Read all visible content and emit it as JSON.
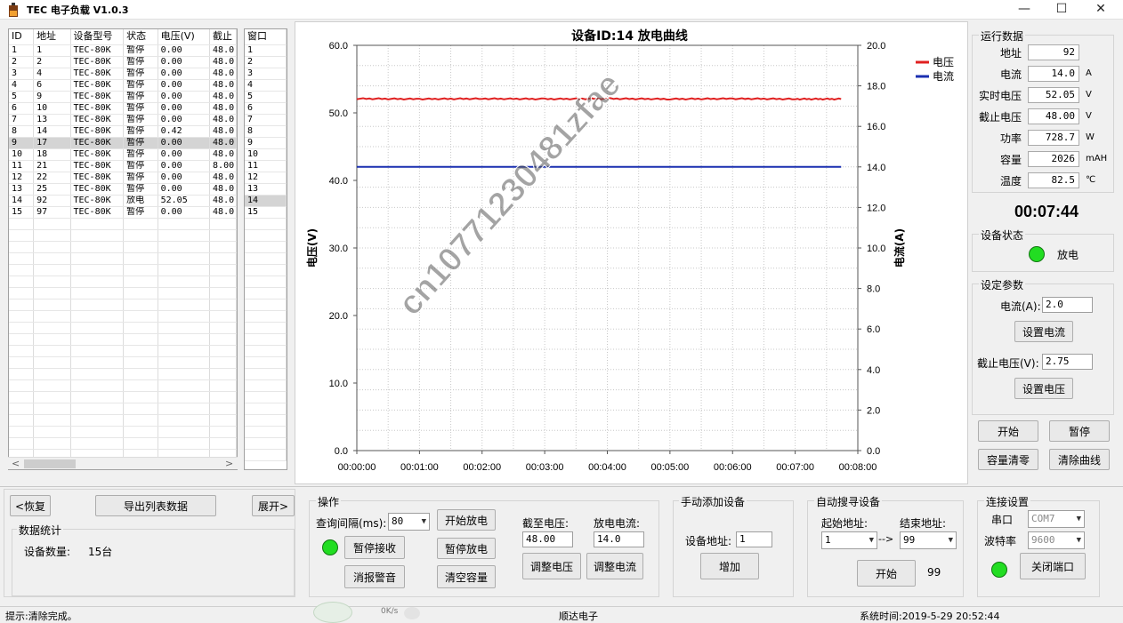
{
  "window": {
    "title": "TEC 电子负载 V1.0.3",
    "minimize": "—",
    "maximize": "☐",
    "close": "✕"
  },
  "device_table": {
    "headers": [
      "ID",
      "地址",
      "设备型号",
      "状态",
      "电压(V)",
      "截止"
    ],
    "rows": [
      [
        "1",
        "1",
        "TEC-80K",
        "暂停",
        "0.00",
        "48.0"
      ],
      [
        "2",
        "2",
        "TEC-80K",
        "暂停",
        "0.00",
        "48.0"
      ],
      [
        "3",
        "4",
        "TEC-80K",
        "暂停",
        "0.00",
        "48.0"
      ],
      [
        "4",
        "6",
        "TEC-80K",
        "暂停",
        "0.00",
        "48.0"
      ],
      [
        "5",
        "9",
        "TEC-80K",
        "暂停",
        "0.00",
        "48.0"
      ],
      [
        "6",
        "10",
        "TEC-80K",
        "暂停",
        "0.00",
        "48.0"
      ],
      [
        "7",
        "13",
        "TEC-80K",
        "暂停",
        "0.00",
        "48.0"
      ],
      [
        "8",
        "14",
        "TEC-80K",
        "暂停",
        "0.42",
        "48.0"
      ],
      [
        "9",
        "17",
        "TEC-80K",
        "暂停",
        "0.00",
        "48.0"
      ],
      [
        "10",
        "18",
        "TEC-80K",
        "暂停",
        "0.00",
        "48.0"
      ],
      [
        "11",
        "21",
        "TEC-80K",
        "暂停",
        "0.00",
        "8.00"
      ],
      [
        "12",
        "22",
        "TEC-80K",
        "暂停",
        "0.00",
        "48.0"
      ],
      [
        "13",
        "25",
        "TEC-80K",
        "暂停",
        "0.00",
        "48.0"
      ],
      [
        "14",
        "92",
        "TEC-80K",
        "放电",
        "52.05",
        "48.0"
      ],
      [
        "15",
        "97",
        "TEC-80K",
        "暂停",
        "0.00",
        "48.0"
      ]
    ],
    "selected_row": 9,
    "scroll_left": "<",
    "scroll_right": ">"
  },
  "window_table": {
    "header": "窗口",
    "rows": [
      "1",
      "2",
      "3",
      "4",
      "5",
      "6",
      "7",
      "8",
      "9",
      "10",
      "11",
      "12",
      "13",
      "14",
      "15"
    ],
    "selected_row": 14
  },
  "chart_data": {
    "type": "line",
    "title": "设备ID:14 放电曲线",
    "ylabel": "电压(V)",
    "y2label": "电流(A)",
    "ylim": [
      0,
      60
    ],
    "y2lim": [
      0,
      20
    ],
    "y_ticks": [
      "0.0",
      "10.0",
      "20.0",
      "30.0",
      "40.0",
      "50.0",
      "60.0"
    ],
    "y2_ticks": [
      "0.0",
      "2.0",
      "4.0",
      "6.0",
      "8.0",
      "10.0",
      "12.0",
      "14.0",
      "16.0",
      "18.0",
      "20.0"
    ],
    "x_ticks": [
      "00:00:00",
      "00:01:00",
      "00:02:00",
      "00:03:00",
      "00:04:00",
      "00:05:00",
      "00:06:00",
      "00:07:00",
      "00:08:00"
    ],
    "xlim_seconds": [
      0,
      480
    ],
    "grid": true,
    "legend_position": "top-right",
    "series": [
      {
        "name": "电压",
        "axis": "left",
        "color": "#e02020",
        "x_seconds": [
          0,
          60,
          120,
          180,
          240,
          300,
          360,
          420,
          464
        ],
        "values": [
          52.1,
          52.05,
          52.1,
          52.05,
          52.1,
          52.05,
          52.1,
          52.05,
          52.05
        ]
      },
      {
        "name": "电流",
        "axis": "right",
        "color": "#1a2fb0",
        "x_seconds": [
          0,
          464
        ],
        "values": [
          14.0,
          14.0
        ]
      }
    ]
  },
  "running_data": {
    "group_label": "运行数据",
    "fields": [
      {
        "label": "地址",
        "value": "92",
        "unit": ""
      },
      {
        "label": "电流",
        "value": "14.0",
        "unit": "A"
      },
      {
        "label": "实时电压",
        "value": "52.05",
        "unit": "V"
      },
      {
        "label": "截止电压",
        "value": "48.00",
        "unit": "V"
      },
      {
        "label": "功率",
        "value": "728.7",
        "unit": "W"
      },
      {
        "label": "容量",
        "value": "2026",
        "unit": "mAH"
      },
      {
        "label": "温度",
        "value": "82.5",
        "unit": "℃"
      }
    ],
    "timer": "00:07:44"
  },
  "device_status": {
    "group_label": "设备状态",
    "status": "放电"
  },
  "set_params": {
    "group_label": "设定参数",
    "current_label": "电流(A):",
    "current_value": "2.0",
    "set_current_button": "设置电流",
    "cutoff_label": "截止电压(V):",
    "cutoff_value": "2.75",
    "set_voltage_button": "设置电压"
  },
  "right_buttons": {
    "start": "开始",
    "pause": "暂停",
    "clear_capacity": "容量清零",
    "clear_curve": "清除曲线"
  },
  "bottom_left": {
    "restore_button": "<恢复",
    "export_button": "导出列表数据",
    "expand_button": "展开>",
    "stats_label": "数据统计",
    "device_count_label": "设备数量:",
    "device_count_value": "15台"
  },
  "operation": {
    "group_label": "操作",
    "interval_label": "查询间隔(ms):",
    "interval_value": "80",
    "start_discharge": "开始放电",
    "pause_receive": "暂停接收",
    "pause_discharge": "暂停放电",
    "clear_alarm": "消报警音",
    "clear_capacity": "清空容量",
    "cutoff_voltage_label": "截至电压:",
    "cutoff_voltage_value": "48.00",
    "discharge_current_label": "放电电流:",
    "discharge_current_value": "14.0",
    "adjust_voltage": "调整电压",
    "adjust_current": "调整电流"
  },
  "manual_add": {
    "group_label": "手动添加设备",
    "address_label": "设备地址:",
    "address_value": "1",
    "add_button": "增加"
  },
  "auto_search": {
    "group_label": "自动搜寻设备",
    "start_addr_label": "起始地址:",
    "end_addr_label": "结束地址:",
    "start_value": "1",
    "arrow": "-->",
    "end_value": "99",
    "start_button": "开始",
    "progress_value": "99"
  },
  "connection": {
    "group_label": "连接设置",
    "port_label": "串口",
    "port_value": "COM7",
    "baud_label": "波特率",
    "baud_value": "9600",
    "close_port_button": "关闭端口"
  },
  "status_bar": {
    "hint": "提示:清除完成。",
    "company": "顺达电子",
    "time": "系统时间:2019-5-29 20:52:44",
    "net_speed": "0K/s"
  },
  "watermark": "cn10771230481zfae"
}
